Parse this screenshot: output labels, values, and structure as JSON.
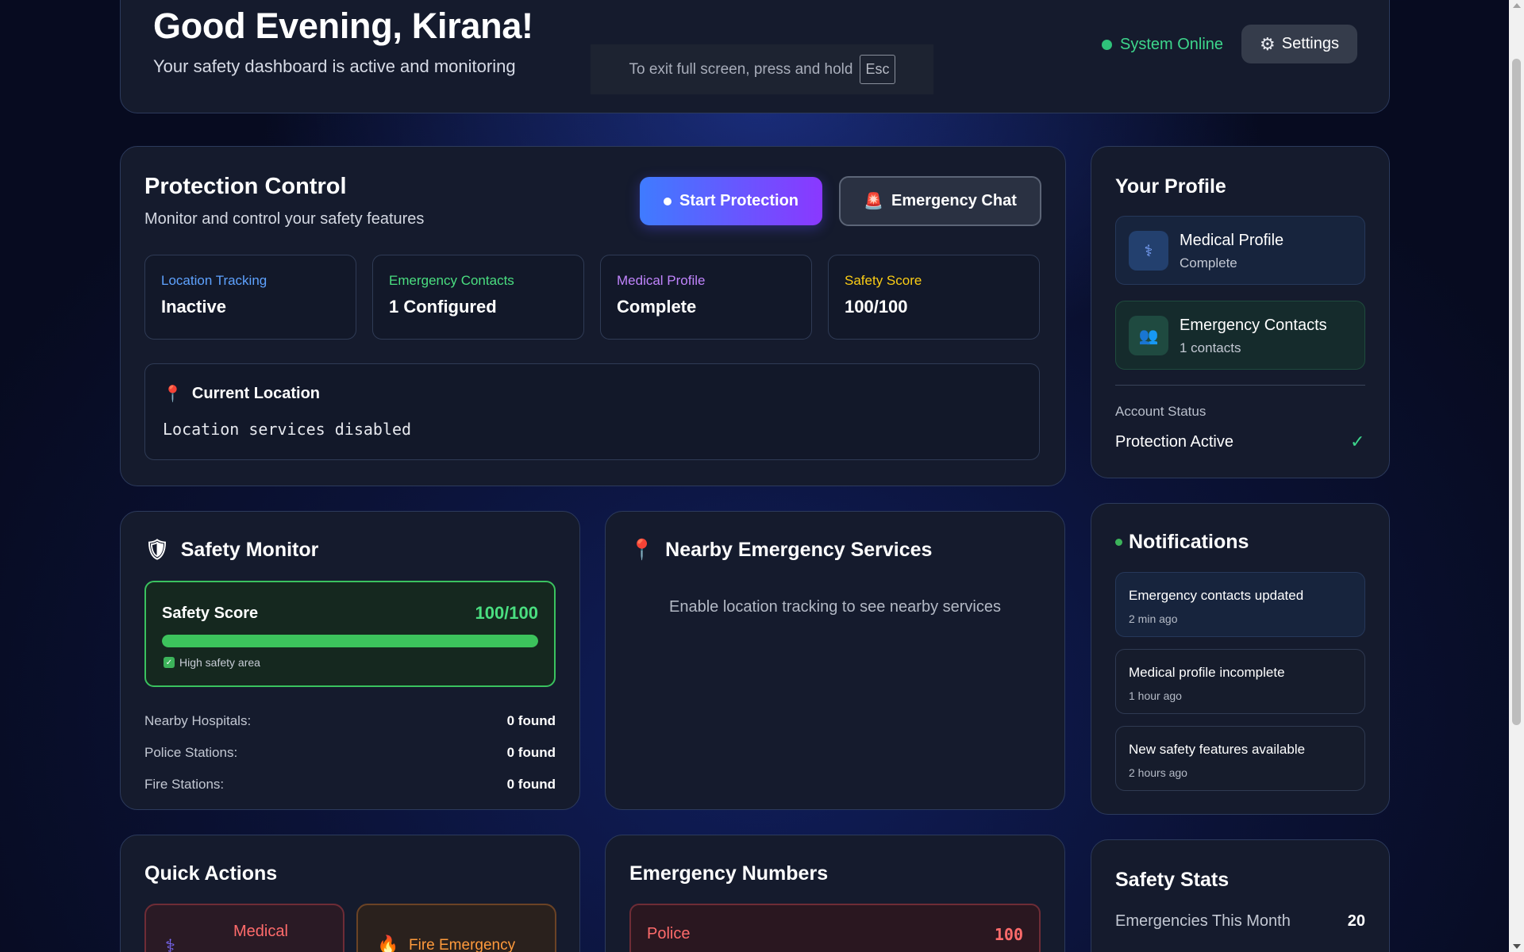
{
  "header": {
    "greeting": "Good Evening, Kirana!",
    "subtitle": "Your safety dashboard is active and monitoring",
    "status": "System Online",
    "settings_label": "Settings",
    "settings_icon": "gear-icon",
    "status_color": "#3dd68c"
  },
  "fullscreen_toast": {
    "text": "To exit full screen, press and hold",
    "key": "Esc"
  },
  "protection": {
    "title": "Protection Control",
    "subtitle": "Monitor and control your safety features",
    "start_label": "Start Protection",
    "chat_label": "Emergency Chat",
    "chat_icon": "siren-icon",
    "stats": [
      {
        "label": "Location Tracking",
        "value": "Inactive",
        "color": "#5ea2ff"
      },
      {
        "label": "Emergency Contacts",
        "value": "1 Configured",
        "color": "#4ade80"
      },
      {
        "label": "Medical Profile",
        "value": "Complete",
        "color": "#c084fc"
      },
      {
        "label": "Safety Score",
        "value": "100/100",
        "color": "#facc15"
      }
    ],
    "location": {
      "title": "Current Location",
      "icon": "pin-icon",
      "text": "Location services disabled"
    }
  },
  "profile": {
    "title": "Your Profile",
    "items": [
      {
        "name": "Medical Profile",
        "sub": "Complete",
        "icon": "stethoscope-icon"
      },
      {
        "name": "Emergency Contacts",
        "sub": "1 contacts",
        "icon": "people-icon"
      }
    ],
    "account_label": "Account Status",
    "account_value": "Protection Active",
    "check": "✓"
  },
  "safety_monitor": {
    "title": "Safety Monitor",
    "icon": "shield-icon",
    "score_label": "Safety Score",
    "score_value": "100/100",
    "score_fraction": 1.0,
    "note": "High safety area",
    "rows": [
      {
        "label": "Nearby Hospitals:",
        "value": "0 found"
      },
      {
        "label": "Police Stations:",
        "value": "0 found"
      },
      {
        "label": "Fire Stations:",
        "value": "0 found"
      }
    ]
  },
  "nearby": {
    "title": "Nearby Emergency Services",
    "icon": "pin-icon",
    "message": "Enable location tracking to see nearby services"
  },
  "notifications": {
    "title": "Notifications",
    "items": [
      {
        "title": "Emergency contacts updated",
        "time": "2 min ago"
      },
      {
        "title": "Medical profile incomplete",
        "time": "1 hour ago"
      },
      {
        "title": "New safety features available",
        "time": "2 hours ago"
      }
    ]
  },
  "quick_actions": {
    "title": "Quick Actions",
    "items": [
      {
        "label": "Medical",
        "icon": "stethoscope-icon"
      },
      {
        "label": "Fire Emergency",
        "icon": "fire-icon"
      }
    ]
  },
  "emergency_numbers": {
    "title": "Emergency Numbers",
    "items": [
      {
        "name": "Police",
        "number": "100"
      }
    ]
  },
  "safety_stats": {
    "title": "Safety Stats",
    "rows": [
      {
        "label": "Emergencies This Month",
        "value": "20"
      }
    ]
  }
}
